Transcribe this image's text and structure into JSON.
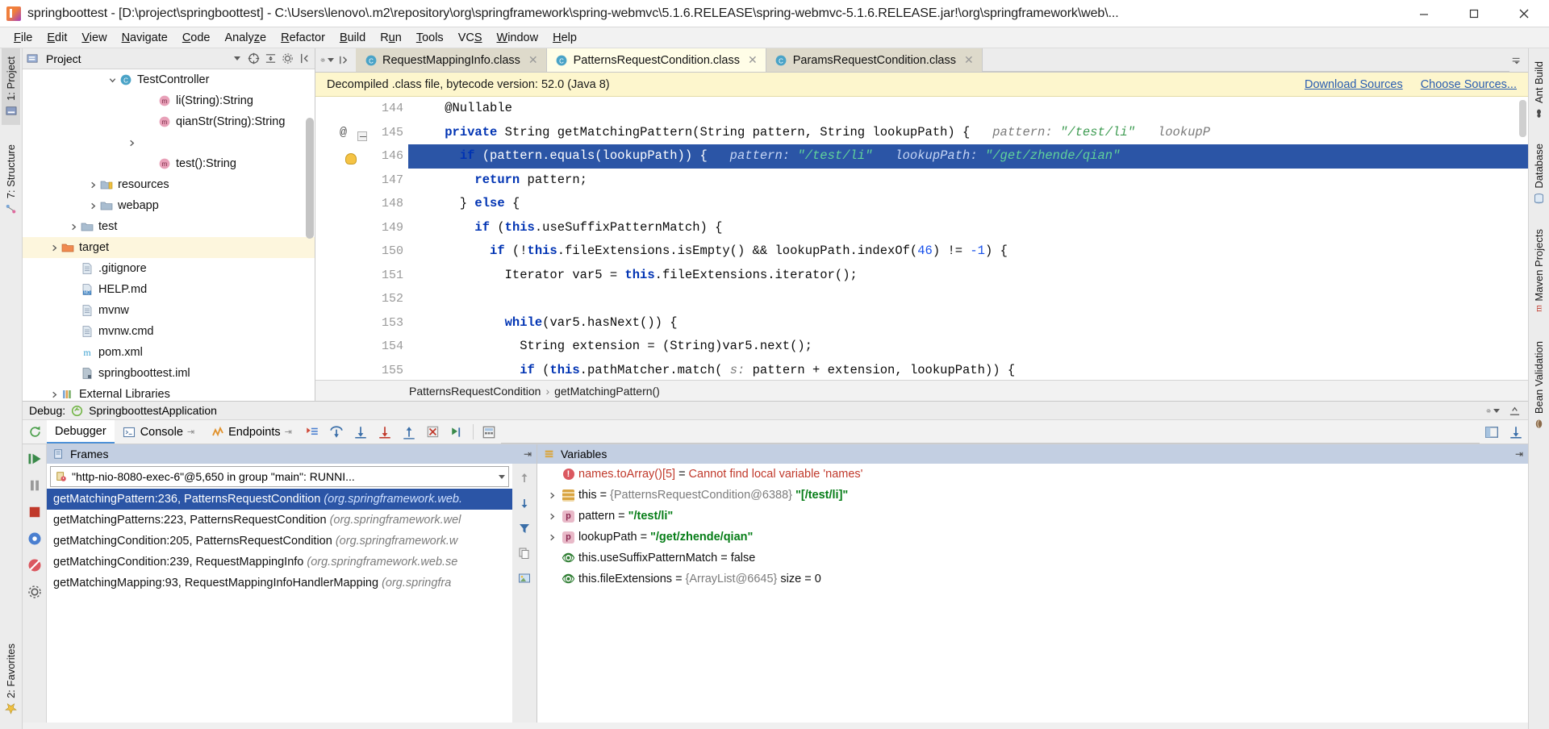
{
  "window": {
    "title": "springboottest - [D:\\project\\springboottest] - C:\\Users\\lenovo\\.m2\\repository\\org\\springframework\\spring-webmvc\\5.1.6.RELEASE\\spring-webmvc-5.1.6.RELEASE.jar!\\org\\springframework\\web\\...",
    "minimize_label": "Minimize",
    "maximize_label": "Maximize",
    "close_label": "Close"
  },
  "menubar": {
    "items": [
      {
        "label": "File",
        "mnemonic": "F"
      },
      {
        "label": "Edit",
        "mnemonic": "E"
      },
      {
        "label": "View",
        "mnemonic": "V"
      },
      {
        "label": "Navigate",
        "mnemonic": "N"
      },
      {
        "label": "Code",
        "mnemonic": "C"
      },
      {
        "label": "Analyze",
        "mnemonic": "z"
      },
      {
        "label": "Refactor",
        "mnemonic": "R"
      },
      {
        "label": "Build",
        "mnemonic": "B"
      },
      {
        "label": "Run",
        "mnemonic": "u"
      },
      {
        "label": "Tools",
        "mnemonic": "T"
      },
      {
        "label": "VCS",
        "mnemonic": "S"
      },
      {
        "label": "Window",
        "mnemonic": "W"
      },
      {
        "label": "Help",
        "mnemonic": "H"
      }
    ]
  },
  "left_strip": {
    "tabs": [
      {
        "label": "1: Project",
        "selected": true,
        "icon": "project-icon"
      },
      {
        "label": "7: Structure",
        "selected": false,
        "icon": "structure-icon"
      }
    ],
    "bottom": [
      {
        "label": "2: Favorites",
        "icon": "favorites-icon"
      }
    ]
  },
  "right_strip": {
    "tabs": [
      {
        "label": "Ant Build",
        "icon": "ant-icon"
      },
      {
        "label": "Database",
        "icon": "database-icon"
      },
      {
        "label": "Maven Projects",
        "icon": "maven-icon"
      },
      {
        "label": "Bean Validation",
        "icon": "bean-icon"
      }
    ]
  },
  "project_panel": {
    "title": "Project",
    "toolbar": [
      {
        "name": "view-options-dropdown",
        "icon": "chevron-down-icon"
      },
      {
        "name": "collapse-scope-icon",
        "icon": "target-icon"
      },
      {
        "name": "expand-all-icon",
        "icon": "expand-icon"
      },
      {
        "name": "settings-icon",
        "icon": "gear-icon"
      },
      {
        "name": "hide-icon",
        "icon": "collapse-icon"
      }
    ],
    "tree": [
      {
        "label": "TestController",
        "icon": "class-icon",
        "indent": 4,
        "arrow": "down",
        "highlight": false
      },
      {
        "label": "li(String):String",
        "icon": "method-icon",
        "indent": 6,
        "arrow": "none",
        "highlight": false
      },
      {
        "label": "qianStr(String):String",
        "icon": "method-icon",
        "indent": 6,
        "arrow": "none",
        "highlight": false
      },
      {
        "label": "",
        "icon": "none",
        "indent": 5,
        "arrow": "right",
        "highlight": false
      },
      {
        "label": "test():String",
        "icon": "method-icon",
        "indent": 6,
        "arrow": "none",
        "highlight": false
      },
      {
        "label": "resources",
        "icon": "resources-folder-icon",
        "indent": 3,
        "arrow": "right",
        "highlight": false
      },
      {
        "label": "webapp",
        "icon": "folder-icon",
        "indent": 3,
        "arrow": "right",
        "highlight": false
      },
      {
        "label": "test",
        "icon": "folder-icon",
        "indent": 2,
        "arrow": "right",
        "highlight": false
      },
      {
        "label": "target",
        "icon": "target-folder-icon",
        "indent": 1,
        "arrow": "right",
        "highlight": true
      },
      {
        "label": ".gitignore",
        "icon": "file-icon",
        "indent": 2,
        "arrow": "none",
        "highlight": false
      },
      {
        "label": "HELP.md",
        "icon": "markdown-icon",
        "indent": 2,
        "arrow": "none",
        "highlight": false
      },
      {
        "label": "mvnw",
        "icon": "file-icon",
        "indent": 2,
        "arrow": "none",
        "highlight": false
      },
      {
        "label": "mvnw.cmd",
        "icon": "file-icon",
        "indent": 2,
        "arrow": "none",
        "highlight": false
      },
      {
        "label": "pom.xml",
        "icon": "maven-file-icon",
        "indent": 2,
        "arrow": "none",
        "highlight": false
      },
      {
        "label": "springboottest.iml",
        "icon": "module-icon",
        "indent": 2,
        "arrow": "none",
        "highlight": false
      },
      {
        "label": "External Libraries",
        "icon": "libraries-icon",
        "indent": 1,
        "arrow": "right",
        "highlight": false
      }
    ]
  },
  "editor": {
    "tabs": [
      {
        "label": "RequestMappingInfo.class",
        "active": false,
        "icon": "class-file-icon"
      },
      {
        "label": "PatternsRequestCondition.class",
        "active": true,
        "icon": "class-file-icon"
      },
      {
        "label": "ParamsRequestCondition.class",
        "active": false,
        "icon": "class-file-icon"
      }
    ],
    "notification": {
      "text": "Decompiled .class file, bytecode version: 52.0 (Java 8)",
      "links": [
        "Download Sources",
        "Choose Sources..."
      ]
    },
    "lines": [
      {
        "num": "144",
        "indent": 2,
        "tokens": [
          {
            "t": "@Nullable",
            "c": "plain"
          }
        ],
        "selected": false,
        "marker": "none",
        "fold": false
      },
      {
        "num": "145",
        "indent": 2,
        "tokens": [
          {
            "t": "private ",
            "c": "kw"
          },
          {
            "t": "String getMatchingPattern(String pattern, String lookupPath) {",
            "c": "plain"
          },
          {
            "t": "   pattern:",
            "c": "param"
          },
          {
            "t": " \"/test/li\"",
            "c": "hint"
          },
          {
            "t": "   lookupP",
            "c": "param"
          }
        ],
        "selected": false,
        "marker": "at",
        "fold": true
      },
      {
        "num": "146",
        "indent": 3,
        "tokens": [
          {
            "t": "if ",
            "c": "kw"
          },
          {
            "t": "(pattern.equals(lookupPath)) {",
            "c": "plain"
          },
          {
            "t": "   pattern:",
            "c": "param"
          },
          {
            "t": " \"/test/li\"",
            "c": "hint"
          },
          {
            "t": "   lookupPath:",
            "c": "param"
          },
          {
            "t": " \"/get/zhende/qian\"",
            "c": "hint"
          }
        ],
        "selected": true,
        "marker": "bulb",
        "fold": false
      },
      {
        "num": "147",
        "indent": 4,
        "tokens": [
          {
            "t": "return ",
            "c": "kw"
          },
          {
            "t": "pattern;",
            "c": "plain"
          }
        ],
        "selected": false,
        "marker": "none",
        "fold": false
      },
      {
        "num": "148",
        "indent": 3,
        "tokens": [
          {
            "t": "} ",
            "c": "plain"
          },
          {
            "t": "else ",
            "c": "kw"
          },
          {
            "t": "{",
            "c": "plain"
          }
        ],
        "selected": false,
        "marker": "none",
        "fold": false
      },
      {
        "num": "149",
        "indent": 4,
        "tokens": [
          {
            "t": "if ",
            "c": "kw"
          },
          {
            "t": "(",
            "c": "plain"
          },
          {
            "t": "this",
            "c": "kw"
          },
          {
            "t": ".useSuffixPatternMatch) {",
            "c": "plain"
          }
        ],
        "selected": false,
        "marker": "none",
        "fold": false
      },
      {
        "num": "150",
        "indent": 5,
        "tokens": [
          {
            "t": "if ",
            "c": "kw"
          },
          {
            "t": "(!",
            "c": "plain"
          },
          {
            "t": "this",
            "c": "kw"
          },
          {
            "t": ".fileExtensions.isEmpty() && lookupPath.indexOf(",
            "c": "plain"
          },
          {
            "t": "46",
            "c": "num"
          },
          {
            "t": ") != ",
            "c": "plain"
          },
          {
            "t": "-1",
            "c": "num"
          },
          {
            "t": ") {",
            "c": "plain"
          }
        ],
        "selected": false,
        "marker": "none",
        "fold": false
      },
      {
        "num": "151",
        "indent": 6,
        "tokens": [
          {
            "t": "Iterator var5 = ",
            "c": "plain"
          },
          {
            "t": "this",
            "c": "kw"
          },
          {
            "t": ".fileExtensions.iterator();",
            "c": "plain"
          }
        ],
        "selected": false,
        "marker": "none",
        "fold": false
      },
      {
        "num": "152",
        "indent": 6,
        "tokens": [],
        "selected": false,
        "marker": "none",
        "fold": false
      },
      {
        "num": "153",
        "indent": 6,
        "tokens": [
          {
            "t": "while",
            "c": "kw"
          },
          {
            "t": "(var5.hasNext()) {",
            "c": "plain"
          }
        ],
        "selected": false,
        "marker": "none",
        "fold": false
      },
      {
        "num": "154",
        "indent": 7,
        "tokens": [
          {
            "t": "String extension = (String)var5.next();",
            "c": "plain"
          }
        ],
        "selected": false,
        "marker": "none",
        "fold": false
      },
      {
        "num": "155",
        "indent": 7,
        "tokens": [
          {
            "t": "if ",
            "c": "kw"
          },
          {
            "t": "(",
            "c": "plain"
          },
          {
            "t": "this",
            "c": "kw"
          },
          {
            "t": ".pathMatcher.match(",
            "c": "plain"
          },
          {
            "t": " s:",
            "c": "param"
          },
          {
            "t": " pattern + extension, lookupPath)) {",
            "c": "plain"
          }
        ],
        "selected": false,
        "marker": "none",
        "fold": false
      }
    ],
    "breadcrumb": [
      "PatternsRequestCondition",
      "getMatchingPattern()"
    ]
  },
  "debug": {
    "title_label": "Debug:",
    "config_name": "SpringboottestApplication",
    "tabs": [
      {
        "label": "Debugger",
        "active": true,
        "icon": "debugger-icon"
      },
      {
        "label": "Console",
        "active": false,
        "icon": "console-icon"
      },
      {
        "label": "Endpoints",
        "active": false,
        "icon": "endpoints-icon"
      }
    ],
    "toolbar_icons": [
      "show-execution-point-icon",
      "step-over-icon",
      "step-into-icon",
      "force-step-into-icon",
      "step-out-icon",
      "drop-frame-icon",
      "run-to-cursor-icon",
      "evaluate-expression-icon"
    ],
    "left_actions": [
      "rerun-icon",
      "resume-icon",
      "pause-icon",
      "stop-icon",
      "view-breakpoints-icon",
      "mute-breakpoints-icon",
      "settings-icon",
      "pin-icon"
    ],
    "frames": {
      "title": "Frames",
      "thread": "\"http-nio-8080-exec-6\"@5,650 in group \"main\": RUNNI...",
      "items": [
        {
          "method": "getMatchingPattern:236, PatternsRequestCondition",
          "pkg": "(org.springframework.web.",
          "selected": true
        },
        {
          "method": "getMatchingPatterns:223, PatternsRequestCondition",
          "pkg": "(org.springframework.wel",
          "selected": false
        },
        {
          "method": "getMatchingCondition:205, PatternsRequestCondition",
          "pkg": "(org.springframework.w",
          "selected": false
        },
        {
          "method": "getMatchingCondition:239, RequestMappingInfo",
          "pkg": "(org.springframework.web.se",
          "selected": false
        },
        {
          "method": "getMatchingMapping:93, RequestMappingInfoHandlerMapping",
          "pkg": "(org.springfra",
          "selected": false
        }
      ]
    },
    "variables": {
      "title": "Variables",
      "items": [
        {
          "icon": "error-icon",
          "name": "names.toArray()[5]",
          "eq": "=",
          "value": "Cannot find local variable 'names'",
          "value_kind": "error",
          "expandable": false
        },
        {
          "icon": "this-icon",
          "name": "this",
          "eq": "=",
          "value": "{PatternsRequestCondition@6388} \"[/test/li]\"",
          "value_kind": "mixed",
          "expandable": true
        },
        {
          "icon": "param-icon",
          "name": "pattern",
          "eq": "=",
          "value": "\"/test/li\"",
          "value_kind": "string",
          "expandable": true
        },
        {
          "icon": "param-icon",
          "name": "lookupPath",
          "eq": "=",
          "value": "\"/get/zhende/qian\"",
          "value_kind": "string",
          "expandable": true
        },
        {
          "icon": "watch-icon",
          "name": "this.useSuffixPatternMatch",
          "eq": "=",
          "value": "false",
          "value_kind": "plain",
          "expandable": false
        },
        {
          "icon": "watch-icon",
          "name": "this.fileExtensions",
          "eq": "=",
          "value": "{ArrayList@6645}  size = 0",
          "value_kind": "mixed",
          "expandable": false
        }
      ]
    }
  },
  "colors": {
    "accent": "#2b55a6",
    "highlight_row": "#fdf6dd",
    "notification_bg": "#fdf6cd",
    "link": "#2a5db0",
    "error": "#c0392b",
    "string_green": "#067d17",
    "keyword_blue": "#0033b3"
  }
}
